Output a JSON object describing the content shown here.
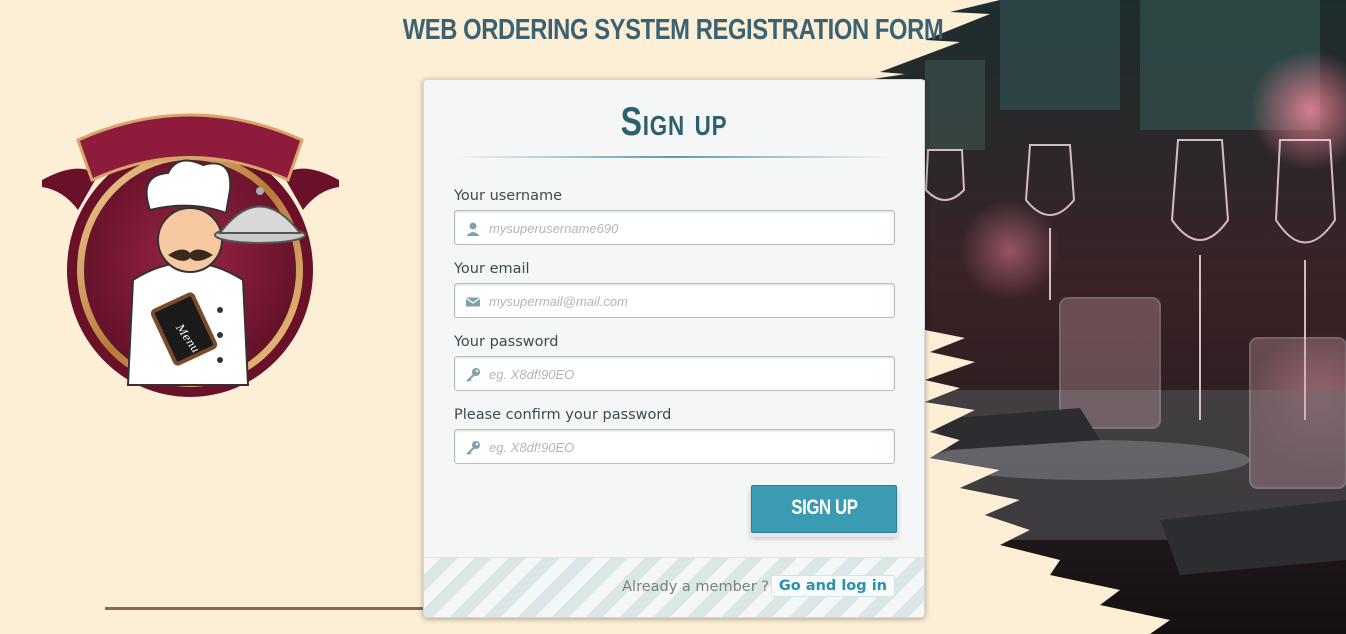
{
  "header": {
    "title": "WEB ORDERING SYSTEM REGISTRATION FORM"
  },
  "logo": {
    "menu_text": "Menu"
  },
  "form": {
    "title": "Sign up",
    "fields": [
      {
        "label": "Your username",
        "placeholder": "mysuperusername690",
        "icon": "user-icon"
      },
      {
        "label": "Your email",
        "placeholder": "mysupermail@mail.com",
        "icon": "envelope-icon"
      },
      {
        "label": "Your password",
        "placeholder": "eg. X8df!90EO",
        "icon": "key-icon"
      },
      {
        "label": "Please confirm your password",
        "placeholder": "eg. X8df!90EO",
        "icon": "key-icon"
      }
    ],
    "submit_label": "SIGN UP",
    "footer": {
      "member_text": "Already a member ?",
      "login_link": "Go and log in"
    }
  },
  "colors": {
    "background": "#fdefd6",
    "title": "#3b6273",
    "button": "#3a9bb3",
    "link": "#2b8fad",
    "logo_maroon": "#7d1734"
  }
}
